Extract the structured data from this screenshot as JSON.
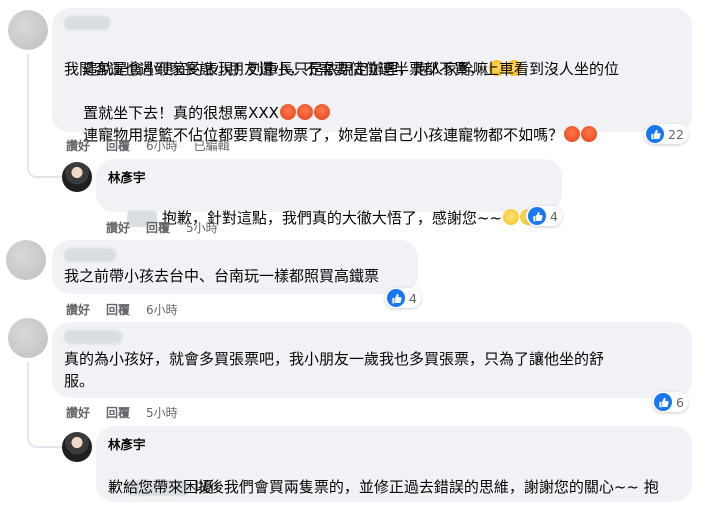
{
  "comments": [
    {
      "text": "這就是貪小便宜的表現！列車長只是依規定辦理，炮人家幹嘛",
      "line2": "我開客運也遇到家長說小朋友還小，不需要佔位連半票都不買，上車看到沒人坐的位",
      "line3": "置就坐下去！真的很想罵XXX",
      "line4": "連寵物用提籃不佔位都要買寵物票了，妳是當自己小孩連寵物都不如嗎？",
      "like": "讚好",
      "reply": "回覆",
      "time": "6小時",
      "edited": "已編輯",
      "reactions": "22"
    },
    {
      "author": "林彥宇",
      "text": "抱歉，針對這點，我們真的大徹大悟了，感謝您~~",
      "like": "讚好",
      "reply": "回覆",
      "time": "5小時",
      "reactions": "4"
    },
    {
      "text": "我之前帶小孩去台中、台南玩一樣都照買高鐵票",
      "like": "讚好",
      "reply": "回覆",
      "time": "6小時",
      "reactions": "4"
    },
    {
      "line1": "真的為小孩好，就會多買張票吧，我小朋友一歲我也多買張票，只為了讓他坐的舒",
      "line2": "服。",
      "like": "讚好",
      "reply": "回覆",
      "time": "5小時",
      "reactions": "6"
    },
    {
      "author": "林彥宇",
      "line1": "以後我們會買兩隻票的，並修正過去錯誤的思維，謝謝您的關心~~ 抱",
      "line2": "歉給您帶來困擾"
    }
  ],
  "icons": {
    "like": "thumbs-up-icon",
    "sweat": "sweat-emoji-icon",
    "angry": "angry-emoji-icon",
    "tear": "tearful-emoji-icon"
  },
  "colors": {
    "bubble": "#f0f2f5",
    "meta": "#65676b",
    "like_blue": "#1877f2"
  }
}
